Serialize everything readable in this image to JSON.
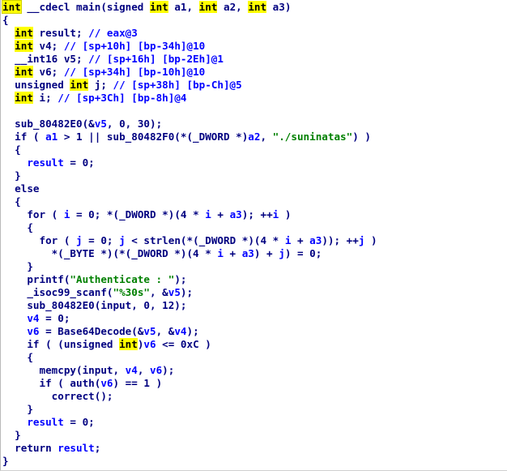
{
  "lines": [
    [
      {
        "t": "int",
        "c": "cur"
      },
      {
        "t": " __cdecl main(signed ",
        "c": "kw"
      },
      {
        "t": "int",
        "c": "hl"
      },
      {
        "t": " a1, ",
        "c": "kw"
      },
      {
        "t": "int",
        "c": "hl"
      },
      {
        "t": " a2, ",
        "c": "kw"
      },
      {
        "t": "int",
        "c": "hl"
      },
      {
        "t": " a3)",
        "c": "kw"
      }
    ],
    [
      {
        "t": "{",
        "c": "kw"
      }
    ],
    [
      {
        "t": "  ",
        "c": "kw"
      },
      {
        "t": "int",
        "c": "hl"
      },
      {
        "t": " result; ",
        "c": "kw"
      },
      {
        "t": "// eax@3",
        "c": "cmt"
      }
    ],
    [
      {
        "t": "  ",
        "c": "kw"
      },
      {
        "t": "int",
        "c": "hl"
      },
      {
        "t": " v4; ",
        "c": "kw"
      },
      {
        "t": "// [sp+10h] [bp-34h]@10",
        "c": "cmt"
      }
    ],
    [
      {
        "t": "  __int16 v5; ",
        "c": "kw"
      },
      {
        "t": "// [sp+16h] [bp-2Eh]@1",
        "c": "cmt"
      }
    ],
    [
      {
        "t": "  ",
        "c": "kw"
      },
      {
        "t": "int",
        "c": "hl"
      },
      {
        "t": " v6; ",
        "c": "kw"
      },
      {
        "t": "// [sp+34h] [bp-10h]@10",
        "c": "cmt"
      }
    ],
    [
      {
        "t": "  unsigned ",
        "c": "kw"
      },
      {
        "t": "int",
        "c": "hl"
      },
      {
        "t": " j; ",
        "c": "kw"
      },
      {
        "t": "// [sp+38h] [bp-Ch]@5",
        "c": "cmt"
      }
    ],
    [
      {
        "t": "  ",
        "c": "kw"
      },
      {
        "t": "int",
        "c": "hl"
      },
      {
        "t": " i; ",
        "c": "kw"
      },
      {
        "t": "// [sp+3Ch] [bp-8h]@4",
        "c": "cmt"
      }
    ],
    [],
    [
      {
        "t": "  sub_80482E0(&",
        "c": "kw"
      },
      {
        "t": "v5",
        "c": "var"
      },
      {
        "t": ", 0, 30);",
        "c": "kw"
      }
    ],
    [
      {
        "t": "  if ( ",
        "c": "kw"
      },
      {
        "t": "a1",
        "c": "var"
      },
      {
        "t": " > 1 || sub_80482F0(*(_DWORD *)",
        "c": "kw"
      },
      {
        "t": "a2",
        "c": "var"
      },
      {
        "t": ", ",
        "c": "kw"
      },
      {
        "t": "\"./suninatas\"",
        "c": "str"
      },
      {
        "t": ") )",
        "c": "kw"
      }
    ],
    [
      {
        "t": "  {",
        "c": "kw"
      }
    ],
    [
      {
        "t": "    ",
        "c": "kw"
      },
      {
        "t": "result",
        "c": "var"
      },
      {
        "t": " = 0;",
        "c": "kw"
      }
    ],
    [
      {
        "t": "  }",
        "c": "kw"
      }
    ],
    [
      {
        "t": "  else",
        "c": "kw"
      }
    ],
    [
      {
        "t": "  {",
        "c": "kw"
      }
    ],
    [
      {
        "t": "    for ( ",
        "c": "kw"
      },
      {
        "t": "i",
        "c": "var"
      },
      {
        "t": " = 0; *(_DWORD *)(4 * ",
        "c": "kw"
      },
      {
        "t": "i",
        "c": "var"
      },
      {
        "t": " + ",
        "c": "kw"
      },
      {
        "t": "a3",
        "c": "var"
      },
      {
        "t": "); ++",
        "c": "kw"
      },
      {
        "t": "i",
        "c": "var"
      },
      {
        "t": " )",
        "c": "kw"
      }
    ],
    [
      {
        "t": "    {",
        "c": "kw"
      }
    ],
    [
      {
        "t": "      for ( ",
        "c": "kw"
      },
      {
        "t": "j",
        "c": "var"
      },
      {
        "t": " = 0; ",
        "c": "kw"
      },
      {
        "t": "j",
        "c": "var"
      },
      {
        "t": " < strlen(*(_DWORD *)(4 * ",
        "c": "kw"
      },
      {
        "t": "i",
        "c": "var"
      },
      {
        "t": " + ",
        "c": "kw"
      },
      {
        "t": "a3",
        "c": "var"
      },
      {
        "t": ")); ++",
        "c": "kw"
      },
      {
        "t": "j",
        "c": "var"
      },
      {
        "t": " )",
        "c": "kw"
      }
    ],
    [
      {
        "t": "        *(_BYTE *)(*(_DWORD *)(4 * ",
        "c": "kw"
      },
      {
        "t": "i",
        "c": "var"
      },
      {
        "t": " + ",
        "c": "kw"
      },
      {
        "t": "a3",
        "c": "var"
      },
      {
        "t": ") + ",
        "c": "kw"
      },
      {
        "t": "j",
        "c": "var"
      },
      {
        "t": ") = 0;",
        "c": "kw"
      }
    ],
    [
      {
        "t": "    }",
        "c": "kw"
      }
    ],
    [
      {
        "t": "    printf(",
        "c": "kw"
      },
      {
        "t": "\"Authenticate : \"",
        "c": "str"
      },
      {
        "t": ");",
        "c": "kw"
      }
    ],
    [
      {
        "t": "    _isoc99_scanf(",
        "c": "kw"
      },
      {
        "t": "\"%30s\"",
        "c": "str"
      },
      {
        "t": ", &",
        "c": "kw"
      },
      {
        "t": "v5",
        "c": "var"
      },
      {
        "t": ");",
        "c": "kw"
      }
    ],
    [
      {
        "t": "    sub_80482E0(input, 0, 12);",
        "c": "kw"
      }
    ],
    [
      {
        "t": "    ",
        "c": "kw"
      },
      {
        "t": "v4",
        "c": "var"
      },
      {
        "t": " = 0;",
        "c": "kw"
      }
    ],
    [
      {
        "t": "    ",
        "c": "kw"
      },
      {
        "t": "v6",
        "c": "var"
      },
      {
        "t": " = Base64Decode(&",
        "c": "kw"
      },
      {
        "t": "v5",
        "c": "var"
      },
      {
        "t": ", &",
        "c": "kw"
      },
      {
        "t": "v4",
        "c": "var"
      },
      {
        "t": ");",
        "c": "kw"
      }
    ],
    [
      {
        "t": "    if ( (unsigned ",
        "c": "kw"
      },
      {
        "t": "int",
        "c": "hl"
      },
      {
        "t": ")",
        "c": "kw"
      },
      {
        "t": "v6",
        "c": "var"
      },
      {
        "t": " <= 0xC )",
        "c": "kw"
      }
    ],
    [
      {
        "t": "    {",
        "c": "kw"
      }
    ],
    [
      {
        "t": "      memcpy(input, ",
        "c": "kw"
      },
      {
        "t": "v4",
        "c": "var"
      },
      {
        "t": ", ",
        "c": "kw"
      },
      {
        "t": "v6",
        "c": "var"
      },
      {
        "t": ");",
        "c": "kw"
      }
    ],
    [
      {
        "t": "      if ( auth(",
        "c": "kw"
      },
      {
        "t": "v6",
        "c": "var"
      },
      {
        "t": ") == 1 )",
        "c": "kw"
      }
    ],
    [
      {
        "t": "        correct();",
        "c": "kw"
      }
    ],
    [
      {
        "t": "    }",
        "c": "kw"
      }
    ],
    [
      {
        "t": "    ",
        "c": "kw"
      },
      {
        "t": "result",
        "c": "var"
      },
      {
        "t": " = 0;",
        "c": "kw"
      }
    ],
    [
      {
        "t": "  }",
        "c": "kw"
      }
    ],
    [
      {
        "t": "  return ",
        "c": "kw"
      },
      {
        "t": "result",
        "c": "var"
      },
      {
        "t": ";",
        "c": "kw"
      }
    ],
    [
      {
        "t": "}",
        "c": "kw"
      }
    ]
  ]
}
